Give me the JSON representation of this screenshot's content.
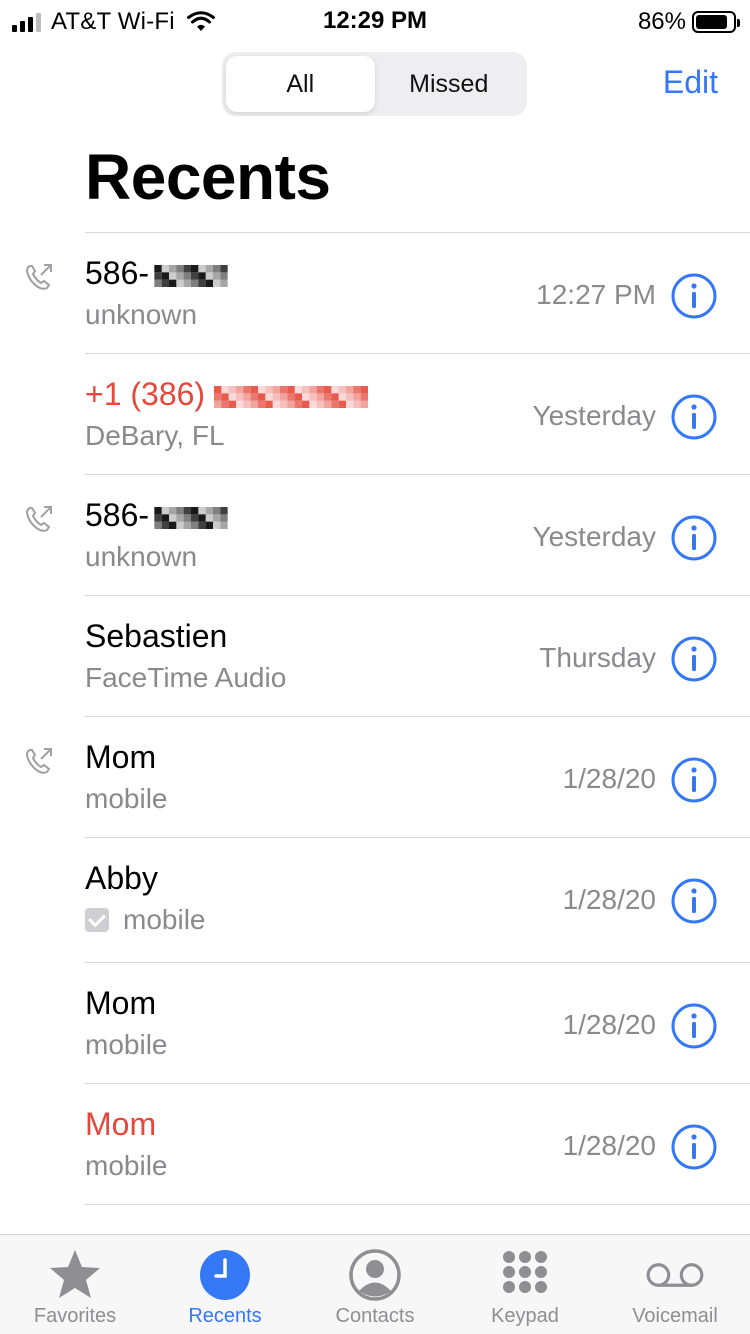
{
  "status_bar": {
    "carrier": "AT&T Wi-Fi",
    "time": "12:29 PM",
    "battery": "86%",
    "battery_level": 0.86
  },
  "header": {
    "segments": [
      "All",
      "Missed"
    ],
    "active_segment": "All",
    "edit_label": "Edit",
    "title": "Recents"
  },
  "calls": [
    {
      "name": "586-",
      "detail": "unknown",
      "when": "12:27 PM",
      "missed": false,
      "outgoing": true,
      "redacted": true
    },
    {
      "name": "+1 (386)",
      "detail": "DeBary, FL",
      "when": "Yesterday",
      "missed": true,
      "outgoing": false,
      "redacted": true
    },
    {
      "name": "586-",
      "detail": "unknown",
      "when": "Yesterday",
      "missed": false,
      "outgoing": true,
      "redacted": true
    },
    {
      "name": "Sebastien",
      "detail": "FaceTime Audio",
      "when": "Thursday",
      "missed": false,
      "outgoing": false
    },
    {
      "name": "Mom",
      "detail": "mobile",
      "when": "1/28/20",
      "missed": false,
      "outgoing": true
    },
    {
      "name": "Abby",
      "detail": "mobile",
      "when": "1/28/20",
      "missed": false,
      "outgoing": false,
      "checkbox": true
    },
    {
      "name": "Mom",
      "detail": "mobile",
      "when": "1/28/20",
      "missed": false,
      "outgoing": false
    },
    {
      "name": "Mom",
      "detail": "mobile",
      "when": "1/28/20",
      "missed": true,
      "outgoing": false
    }
  ],
  "tabbar": {
    "tabs": [
      {
        "label": "Favorites",
        "icon": "star-icon"
      },
      {
        "label": "Recents",
        "icon": "clock-icon"
      },
      {
        "label": "Contacts",
        "icon": "person-circle-icon"
      },
      {
        "label": "Keypad",
        "icon": "keypad-icon"
      },
      {
        "label": "Voicemail",
        "icon": "voicemail-icon"
      }
    ],
    "active": "Recents"
  },
  "colors": {
    "accent": "#3478f6",
    "missed": "#e5473b",
    "secondary_text": "#8a8a8e"
  }
}
